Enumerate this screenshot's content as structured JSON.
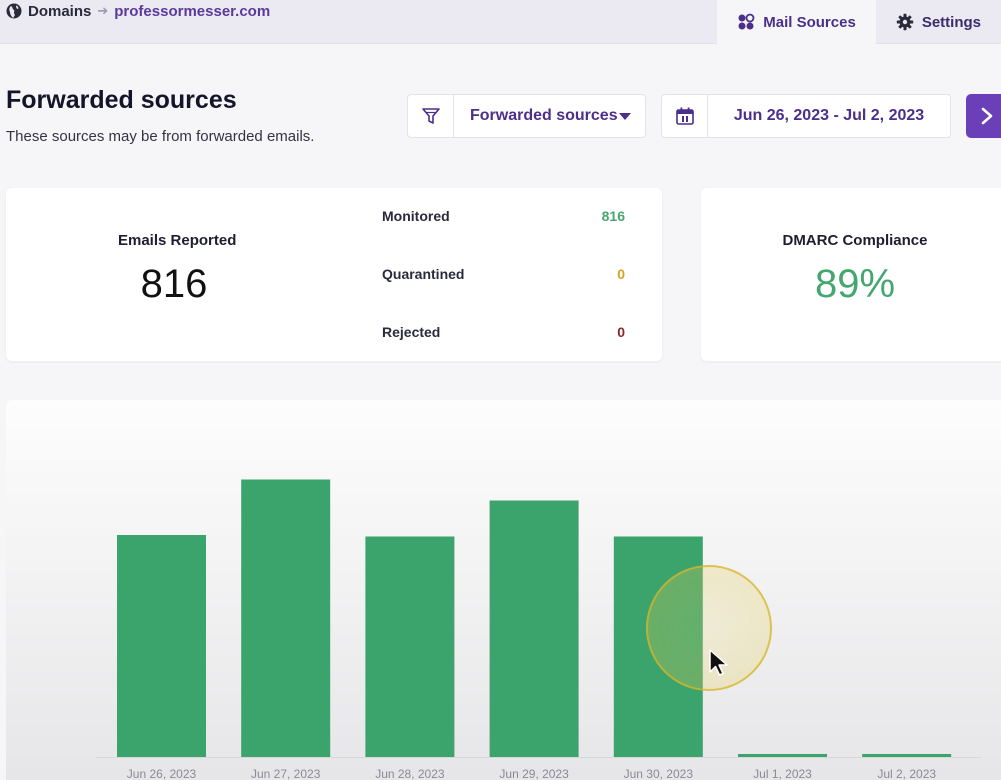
{
  "breadcrumb": {
    "root": "Domains",
    "separator": "➔",
    "current": "professormesser.com"
  },
  "tabs": [
    {
      "label": "Mail Sources",
      "icon": "mail-sources-icon",
      "active": true
    },
    {
      "label": "Settings",
      "icon": "gear-icon",
      "active": false
    }
  ],
  "header": {
    "title": "Forwarded sources",
    "subtitle": "These sources may be from forwarded emails."
  },
  "filter": {
    "icon": "filter-icon",
    "selected": "Forwarded sources"
  },
  "date_range": {
    "icon": "calendar-icon",
    "value": "Jun 26, 2023 - Jul 2, 2023"
  },
  "next_button": {
    "icon": "chevron-right-icon"
  },
  "emails_card": {
    "label": "Emails Reported",
    "value": "816",
    "stats": [
      {
        "label": "Monitored",
        "value": "816",
        "color": "#45a66f"
      },
      {
        "label": "Quarantined",
        "value": "0",
        "color": "#d8a21e"
      },
      {
        "label": "Rejected",
        "value": "0",
        "color": "#8a2b2b"
      }
    ]
  },
  "dmarc_card": {
    "label": "DMARC Compliance",
    "value": "89%"
  },
  "colors": {
    "accent": "#6a3fb8",
    "brand_text": "#4b2f8a",
    "bar": "#3ba36c"
  },
  "chart_data": {
    "type": "bar",
    "categories": [
      "Jun 26, 2023",
      "Jun 27, 2023",
      "Jun 28, 2023",
      "Jun 29, 2023",
      "Jun 30, 2023",
      "Jul 1, 2023",
      "Jul 2, 2023"
    ],
    "values": [
      148,
      185,
      147,
      171,
      147,
      2,
      2
    ],
    "ylim": [
      0,
      200
    ],
    "grid": false,
    "title": "",
    "xlabel": "",
    "ylabel": ""
  }
}
